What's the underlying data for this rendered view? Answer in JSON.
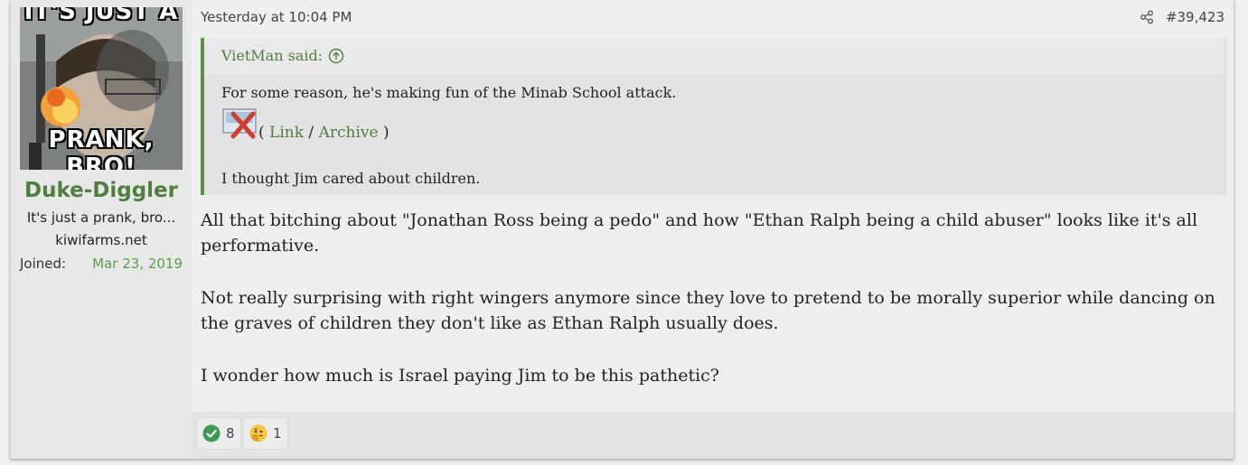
{
  "user": {
    "avatar_top_text": "IT'S JUST A",
    "avatar_bottom_text": "PRANK, BRO!",
    "username": "Duke-Diggler",
    "title": "It's just a prank, bro...",
    "site": "kiwifarms.net",
    "joined_label": "Joined:",
    "joined_value": "Mar 23, 2019"
  },
  "post": {
    "date": "Yesterday at 10:04 PM",
    "number": "#39,423",
    "quote": {
      "author": "VietMan said:",
      "line1": "For some reason, he's making fun of the Minab School attack.",
      "open_paren": "( ",
      "link_label": "Link",
      "separator": " / ",
      "archive_label": "Archive",
      "close_paren": " )",
      "line3": "I thought Jim cared about children."
    },
    "paragraphs": [
      "All that bitching about \"Jonathan Ross being a pedo\" and how \"Ethan Ralph being a child abuser\" looks like it's all performative.",
      "Not really surprising with right wingers anymore since they love to pretend to be morally superior while dancing on the graves of children they don't like as Ethan Ralph usually does.",
      "I wonder how much is Israel paying Jim to be this pathetic?"
    ]
  },
  "reactions": [
    {
      "icon": "check-icon",
      "count": "8"
    },
    {
      "icon": "thinking-face-icon",
      "count": "1"
    }
  ],
  "colors": {
    "accent": "#4f7f3e",
    "quote_border": "#5a8f48",
    "joined_date": "#5b9a4c"
  }
}
